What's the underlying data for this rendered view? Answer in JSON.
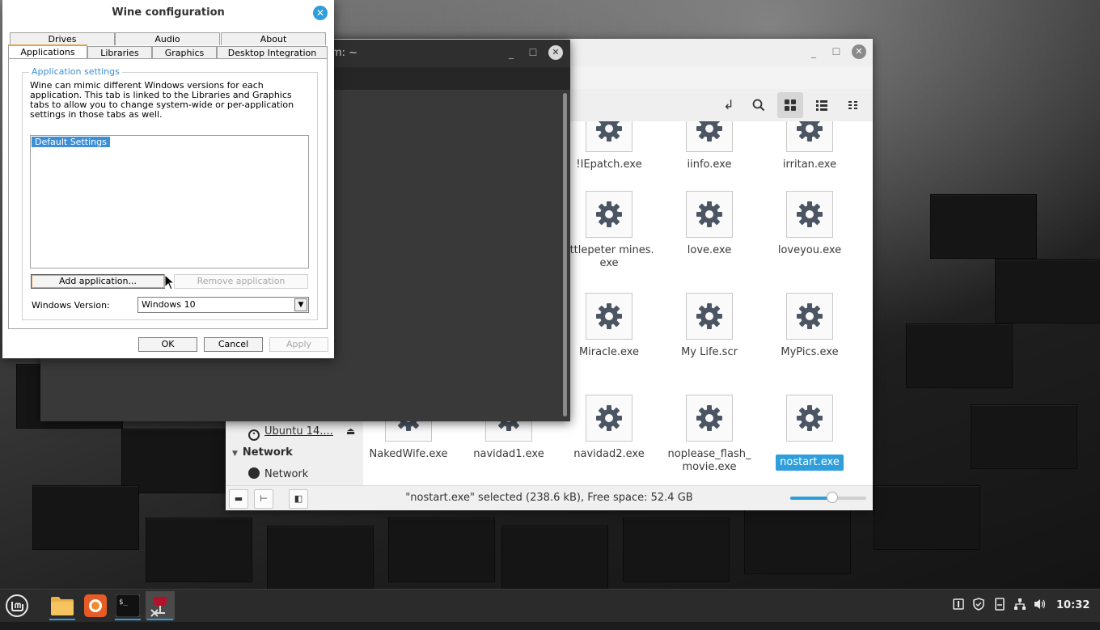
{
  "nemo": {
    "title_fragment": "m: ~",
    "sidebar": {
      "device_label": "Ubuntu 14....",
      "network_header": "Network",
      "network_item": "Network"
    },
    "files": [
      {
        "name": "!IEpatch.exe",
        "selected": false
      },
      {
        "name": "iinfo.exe",
        "selected": false
      },
      {
        "name": "irritan.exe",
        "selected": false
      },
      {
        "name": "littlepeter mines.\nexe",
        "selected": false
      },
      {
        "name": "love.exe",
        "selected": false
      },
      {
        "name": "loveyou.exe",
        "selected": false
      },
      {
        "name": "Miracle.exe",
        "selected": false
      },
      {
        "name": "My Life.scr",
        "selected": false
      },
      {
        "name": "MyPics.exe",
        "selected": false
      },
      {
        "name": "NakedWife.exe",
        "selected": false
      },
      {
        "name": "navidad1.exe",
        "selected": false
      },
      {
        "name": "navidad2.exe",
        "selected": false
      },
      {
        "name": "noplease_flash_\nmovie.exe",
        "selected": false
      },
      {
        "name": "nostart.exe",
        "selected": true
      }
    ],
    "status": "\"nostart.exe\" selected (238.6 kB), Free space: 52.4 GB",
    "zoom_level": 0.55
  },
  "terminal": {
    "title_fragment": "m: ~"
  },
  "wine": {
    "title": "Wine configuration",
    "tabs_row1": [
      "Drives",
      "Audio",
      "About"
    ],
    "tabs_row2": [
      "Applications",
      "Libraries",
      "Graphics",
      "Desktop Integration"
    ],
    "active_tab": "Applications",
    "group_label": "Application settings",
    "description": "Wine can mimic different Windows versions for each application. This tab is linked to the Libraries and Graphics tabs to allow you to change system-wide or per-application settings in those tabs as well.",
    "list_items": [
      "Default Settings"
    ],
    "add_button": "Add application...",
    "remove_button": "Remove application",
    "version_label": "Windows Version:",
    "version_value": "Windows 10",
    "ok": "OK",
    "cancel": "Cancel",
    "apply": "Apply"
  },
  "taskbar": {
    "apps": [
      "menu-icon",
      "files-icon",
      "firefox-icon",
      "terminal-icon",
      "wine-icon"
    ],
    "clock": "10:32"
  },
  "colors": {
    "accent": "#2f9fdb",
    "wine_focus": "#e8a33d"
  }
}
